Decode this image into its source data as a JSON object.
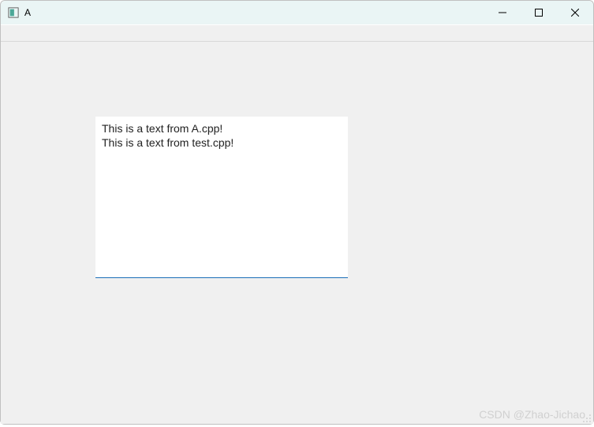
{
  "window": {
    "title": "A"
  },
  "content": {
    "text": "This is a text from A.cpp!\nThis is a text from test.cpp!"
  },
  "watermark": "CSDN @Zhao-Jichao"
}
